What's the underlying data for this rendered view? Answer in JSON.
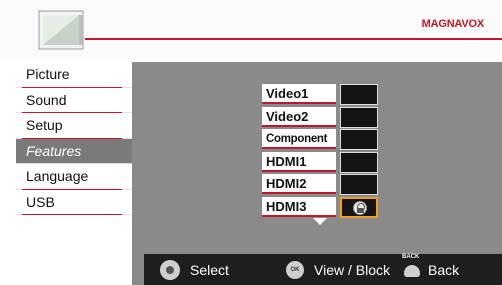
{
  "header": {
    "brand": "MAGNAVOX",
    "icon": "tv-icon",
    "brand_color": "#c0182a"
  },
  "menu": {
    "items": [
      {
        "label": "Picture"
      },
      {
        "label": "Sound"
      },
      {
        "label": "Setup"
      },
      {
        "label": "Features",
        "active": true
      },
      {
        "label": "Language"
      },
      {
        "label": "USB"
      }
    ]
  },
  "inputs": [
    {
      "label": "Video1",
      "blocked": false
    },
    {
      "label": "Video2",
      "blocked": false
    },
    {
      "label": "Component",
      "blocked": false
    },
    {
      "label": "HDMI1",
      "blocked": false
    },
    {
      "label": "HDMI2",
      "blocked": false
    },
    {
      "label": "HDMI3",
      "blocked": true,
      "selected": true
    }
  ],
  "more_indicator": "chevron-down-icon",
  "footer": {
    "select_label": "Select",
    "ok_label": "OK",
    "view_block_label": "View / Block",
    "back_key_label": "BACK",
    "back_label": "Back"
  }
}
